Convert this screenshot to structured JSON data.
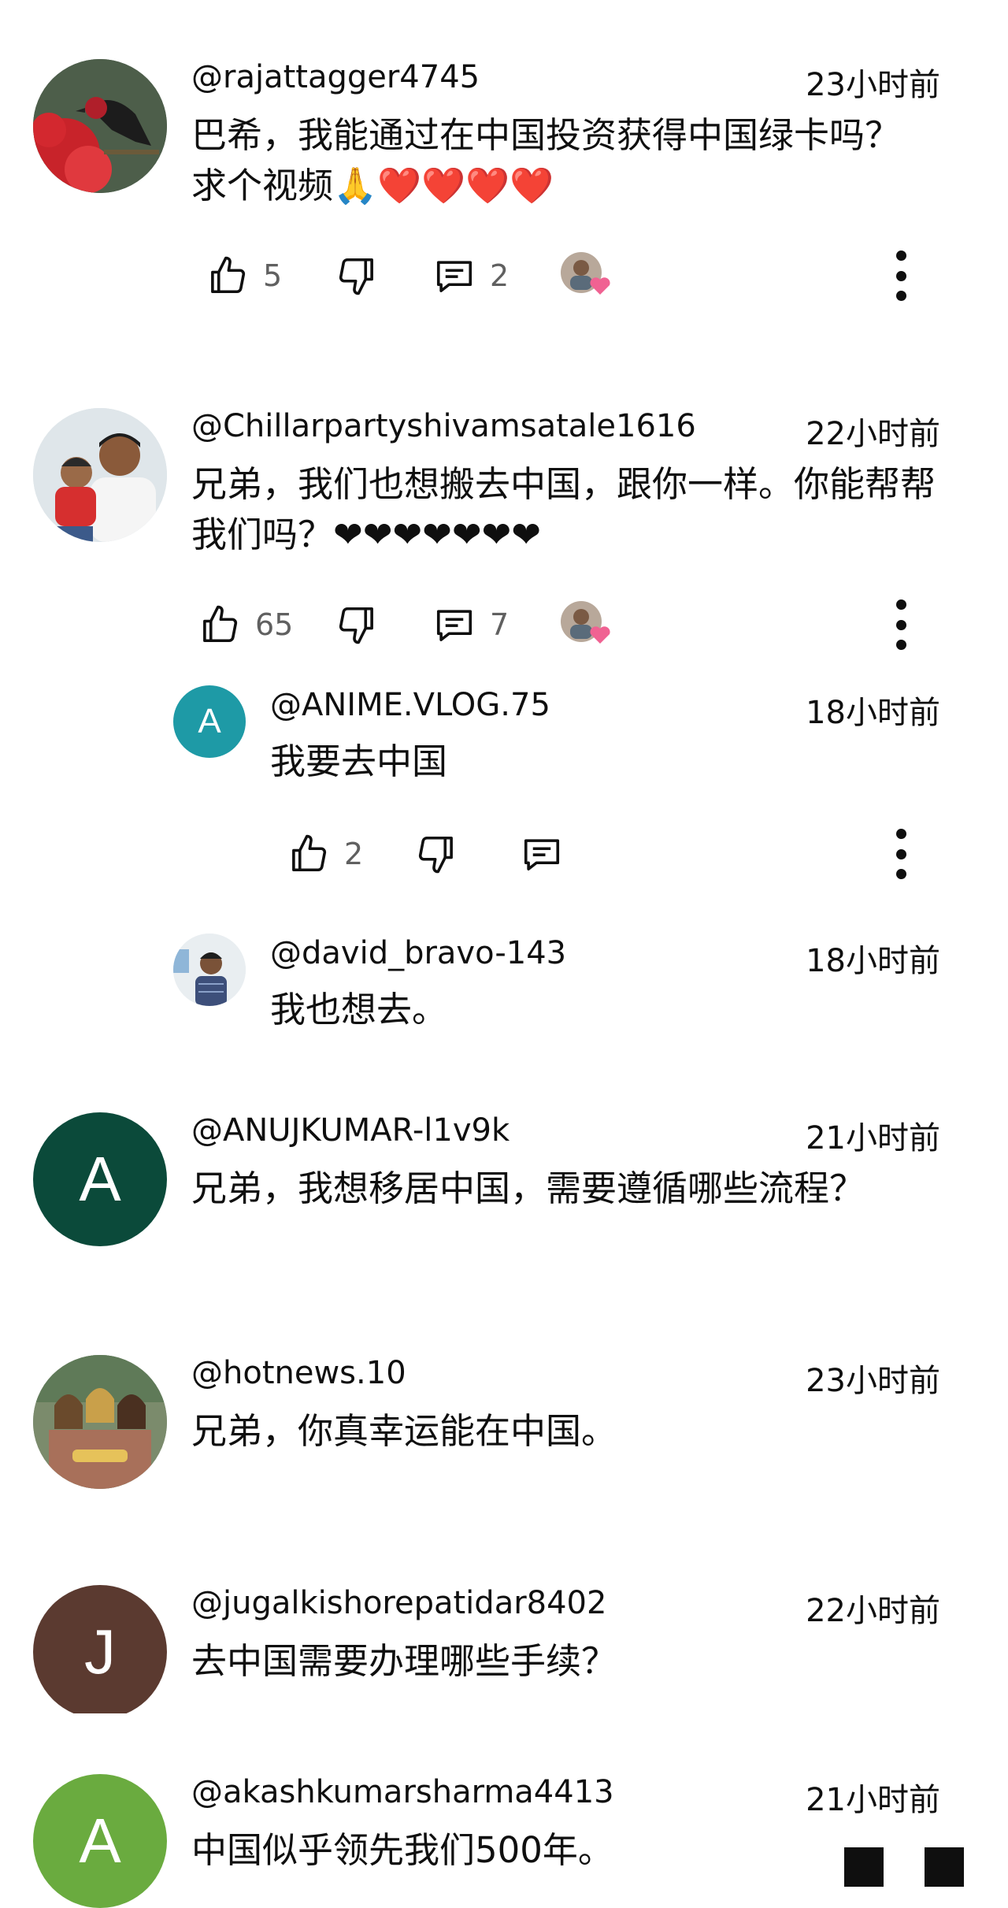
{
  "comments": [
    {
      "handle": "@rajattagger4745",
      "time": "23小时前",
      "text": "巴希，我能通过在中国投资获得中国绿卡吗？求个视频🙏❤️❤️❤️❤️",
      "likes": "5",
      "replies": "2"
    },
    {
      "handle": "@Chillarpartyshivamsatale1616",
      "time": "22小时前",
      "text": "兄弟，我们也想搬去中国，跟你一样。你能帮帮我们吗？❤❤❤❤❤❤❤",
      "likes": "65",
      "replies": "7",
      "thread": [
        {
          "handle": "@ANIME.VLOG.75",
          "avatar_letter": "A",
          "time": "18小时前",
          "text": "我要去中国",
          "likes": "2"
        },
        {
          "handle": "@david_bravo-143",
          "time": "18小时前",
          "text": "我也想去。"
        }
      ]
    },
    {
      "handle": "@ANUJKUMAR-l1v9k",
      "avatar_letter": "A",
      "time": "21小时前",
      "text": "兄弟，我想移居中国，需要遵循哪些流程？"
    },
    {
      "handle": "@hotnews.10",
      "time": "23小时前",
      "text": "兄弟，你真幸运能在中国。"
    },
    {
      "handle": "@jugalkishorepatidar8402",
      "avatar_letter": "J",
      "time": "22小时前",
      "text": "去中国需要办理哪些手续？"
    },
    {
      "handle": "@akashkumarsharma4413",
      "avatar_letter": "A",
      "time": "21小时前",
      "text": "中国似乎领先我们500年。"
    }
  ],
  "colors": {
    "anime_avatar": "#1e9aa6",
    "anuj_avatar": "#0b4a3a",
    "jugal_avatar": "#5b3a30",
    "akash_avatar": "#6aab3f",
    "text": "#0f0f0f",
    "secondary": "#606060"
  },
  "icons": [
    "thumb-up-icon",
    "thumb-down-icon",
    "reply-comment-icon",
    "creator-heart-icon",
    "more-vert-icon"
  ]
}
